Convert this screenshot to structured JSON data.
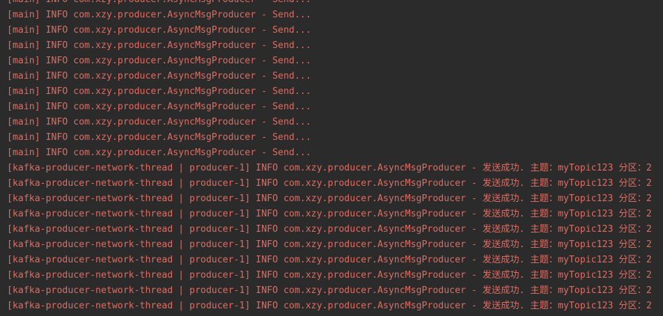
{
  "colors": {
    "background": "#2b2b2b",
    "log_text": "#e06c62"
  },
  "console": {
    "lines": [
      "[main] INFO com.xzy.producer.AsyncMsgProducer - Send...",
      "[main] INFO com.xzy.producer.AsyncMsgProducer - Send...",
      "[main] INFO com.xzy.producer.AsyncMsgProducer - Send...",
      "[main] INFO com.xzy.producer.AsyncMsgProducer - Send...",
      "[main] INFO com.xzy.producer.AsyncMsgProducer - Send...",
      "[main] INFO com.xzy.producer.AsyncMsgProducer - Send...",
      "[main] INFO com.xzy.producer.AsyncMsgProducer - Send...",
      "[main] INFO com.xzy.producer.AsyncMsgProducer - Send...",
      "[main] INFO com.xzy.producer.AsyncMsgProducer - Send...",
      "[main] INFO com.xzy.producer.AsyncMsgProducer - Send...",
      "[main] INFO com.xzy.producer.AsyncMsgProducer - Send...",
      "[kafka-producer-network-thread | producer-1] INFO com.xzy.producer.AsyncMsgProducer - 发送成功. 主题：myTopic123 分区：2",
      "[kafka-producer-network-thread | producer-1] INFO com.xzy.producer.AsyncMsgProducer - 发送成功. 主题：myTopic123 分区：2",
      "[kafka-producer-network-thread | producer-1] INFO com.xzy.producer.AsyncMsgProducer - 发送成功. 主题：myTopic123 分区：2",
      "[kafka-producer-network-thread | producer-1] INFO com.xzy.producer.AsyncMsgProducer - 发送成功. 主题：myTopic123 分区：2",
      "[kafka-producer-network-thread | producer-1] INFO com.xzy.producer.AsyncMsgProducer - 发送成功. 主题：myTopic123 分区：2",
      "[kafka-producer-network-thread | producer-1] INFO com.xzy.producer.AsyncMsgProducer - 发送成功. 主题：myTopic123 分区：2",
      "[kafka-producer-network-thread | producer-1] INFO com.xzy.producer.AsyncMsgProducer - 发送成功. 主题：myTopic123 分区：2",
      "[kafka-producer-network-thread | producer-1] INFO com.xzy.producer.AsyncMsgProducer - 发送成功. 主题：myTopic123 分区：2",
      "[kafka-producer-network-thread | producer-1] INFO com.xzy.producer.AsyncMsgProducer - 发送成功. 主题：myTopic123 分区：2",
      "[kafka-producer-network-thread | producer-1] INFO com.xzy.producer.AsyncMsgProducer - 发送成功. 主题：myTopic123 分区：2"
    ]
  }
}
